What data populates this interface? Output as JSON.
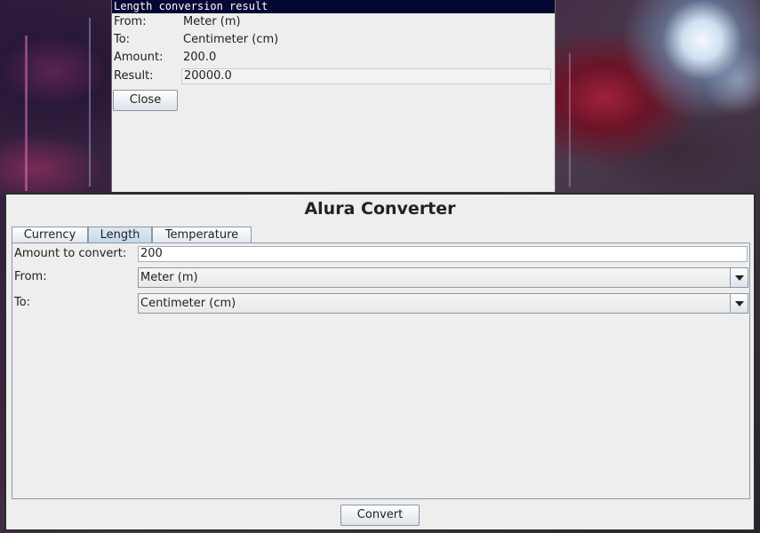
{
  "result_dialog": {
    "title": "Length conversion result",
    "from_label": "From:",
    "from_value": "Meter (m)",
    "to_label": "To:",
    "to_value": "Centimeter (cm)",
    "amount_label": "Amount:",
    "amount_value": "200.0",
    "result_label": "Result:",
    "result_value": "20000.0",
    "close_label": "Close"
  },
  "main_window": {
    "title": "Alura Converter",
    "tabs": [
      {
        "label": "Currency",
        "selected": false
      },
      {
        "label": "Length",
        "selected": true
      },
      {
        "label": "Temperature",
        "selected": false
      }
    ],
    "form": {
      "amount_label": "Amount to convert:",
      "amount_value": "200",
      "from_label": "From:",
      "from_value": "Meter (m)",
      "to_label": "To:",
      "to_value": "Centimeter (cm)"
    },
    "convert_label": "Convert"
  },
  "icons": {
    "combo_arrow": "chevron-down-icon"
  },
  "colors": {
    "dialog_titlebar": "#050833",
    "window_bg": "#eeeeee",
    "selected_tab": "#c4d6ea"
  }
}
